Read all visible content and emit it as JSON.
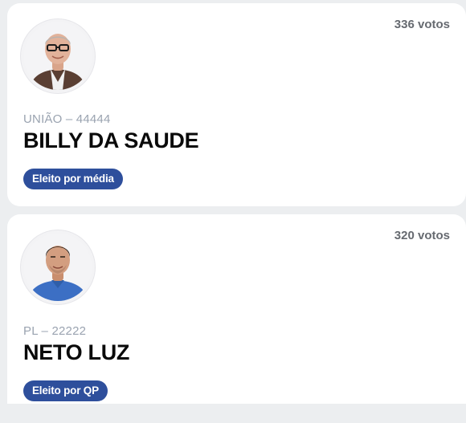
{
  "candidates": [
    {
      "votes": "336 votos",
      "party": "UNIÃO – 44444",
      "name": "BILLY DA SAUDE",
      "status": "Eleito por média"
    },
    {
      "votes": "320 votos",
      "party": "PL – 22222",
      "name": "NETO LUZ",
      "status": "Eleito por QP"
    }
  ],
  "colors": {
    "page_background": "#eceef0",
    "card_background": "#ffffff",
    "badge_background": "#2e4f9c",
    "party_text": "#9aa3b0",
    "votes_text": "#666a70"
  }
}
